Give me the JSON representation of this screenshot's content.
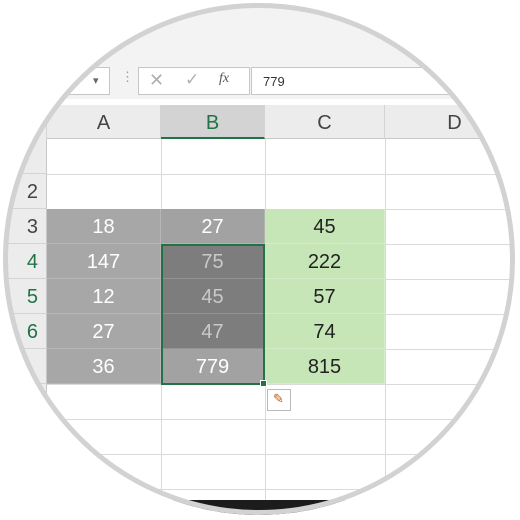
{
  "formula_bar": {
    "name_box_value": "",
    "dropdown_glyph": "▾",
    "separator_glyph": "⋮",
    "cancel_glyph": "✕",
    "enter_glyph": "✓",
    "fx_label": "fx",
    "formula_value": "779"
  },
  "columns": [
    {
      "label": "A"
    },
    {
      "label": "B"
    },
    {
      "label": "C"
    },
    {
      "label": "D"
    }
  ],
  "active_column": "B",
  "rows": [
    {
      "label": ""
    },
    {
      "label": "2"
    },
    {
      "label": "3"
    },
    {
      "label": "4"
    },
    {
      "label": "5"
    },
    {
      "label": "6"
    },
    {
      "label": ""
    }
  ],
  "cells": {
    "A": [
      "18",
      "147",
      "12",
      "27",
      "36"
    ],
    "B": [
      "27",
      "75",
      "45",
      "47",
      "779"
    ],
    "C": [
      "45",
      "222",
      "57",
      "74",
      "815"
    ]
  },
  "quick_analysis_glyph": "✎",
  "colors": {
    "accent_green": "#217346",
    "c_column_fill": "#c6e6b7",
    "gray_fill": "#a7a7a7",
    "selection_fill": "#7d7d7d"
  }
}
